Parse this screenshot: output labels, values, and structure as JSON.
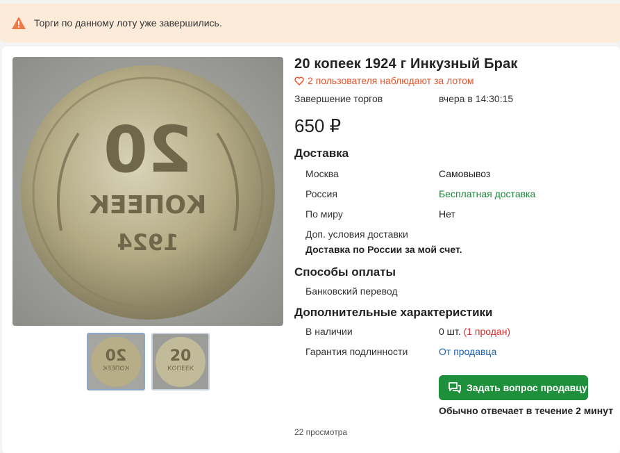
{
  "banner": {
    "icon": "warning-triangle-icon",
    "text": "Торги по данному лоту уже завершились."
  },
  "lot": {
    "title": "20 копеек 1924 г Инкузный Брак",
    "watchers": "2 пользователя наблюдают за лотом",
    "end_label": "Завершение торгов",
    "end_value": "вчера в 14:30:15",
    "price": "650 ₽"
  },
  "delivery": {
    "heading": "Доставка",
    "rows": [
      {
        "label": "Москва",
        "value": "Самовывоз"
      },
      {
        "label": "Россия",
        "value": "Бесплатная доставка"
      },
      {
        "label": "По миру",
        "value": "Нет"
      },
      {
        "label": "Доп. условия доставки",
        "value": ""
      }
    ],
    "note": "Доставка по России за мой счет."
  },
  "payment": {
    "heading": "Способы оплаты",
    "method": "Банковский перевод"
  },
  "extra": {
    "heading": "Дополнительные характеристики",
    "stock_label": "В наличии",
    "stock_value": "0 шт.",
    "stock_sold": "(1 продан)",
    "auth_label": "Гарантия подлинности",
    "auth_value": "От продавца"
  },
  "seller": {
    "ask_button": "Задать вопрос продавцу",
    "reply_time": "Обычно отвечает в течение 2 минут"
  },
  "views": "22 просмотра",
  "colors": {
    "accent_green": "#1e8f3b",
    "watch_orange": "#e8542a",
    "banner_bg": "#fcebd9"
  },
  "coin_photo": {
    "front_text_top": "20",
    "front_text_mid": "КОПЕЕК",
    "front_text_year": "1924"
  }
}
